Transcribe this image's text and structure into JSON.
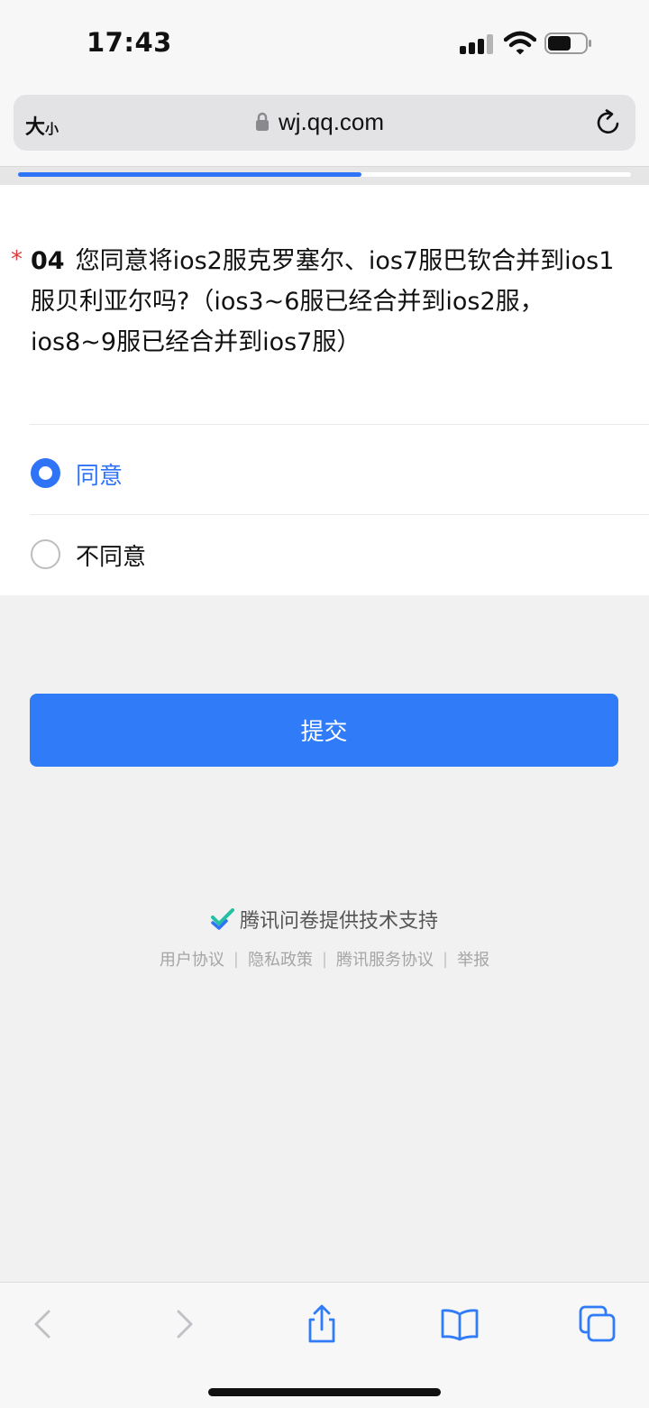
{
  "status_bar": {
    "time": "17:43"
  },
  "address_bar": {
    "text_size_large": "大",
    "text_size_small": "小",
    "url": "wj.qq.com"
  },
  "progress": {
    "value": 0.56
  },
  "question": {
    "required_mark": "*",
    "number": "04",
    "text": "您同意将ios2服克罗塞尔、ios7服巴钦合并到ios1服贝利亚尔吗?（ios3~6服已经合并到ios2服，ios8~9服已经合并到ios7服）",
    "options": [
      {
        "label": "同意",
        "selected": true
      },
      {
        "label": "不同意",
        "selected": false
      }
    ]
  },
  "submit": {
    "label": "提交"
  },
  "footer": {
    "powered_by": "腾讯问卷提供技术支持",
    "links": [
      "用户协议",
      "隐私政策",
      "腾讯服务协议",
      "举报"
    ],
    "separator": "|"
  },
  "colors": {
    "accent": "#2f73f6",
    "required": "#e23b3b",
    "background": "#f1f1f1"
  },
  "toolbar": {
    "icons": [
      "back-icon",
      "forward-icon",
      "share-icon",
      "bookmarks-icon",
      "tabs-icon"
    ]
  }
}
